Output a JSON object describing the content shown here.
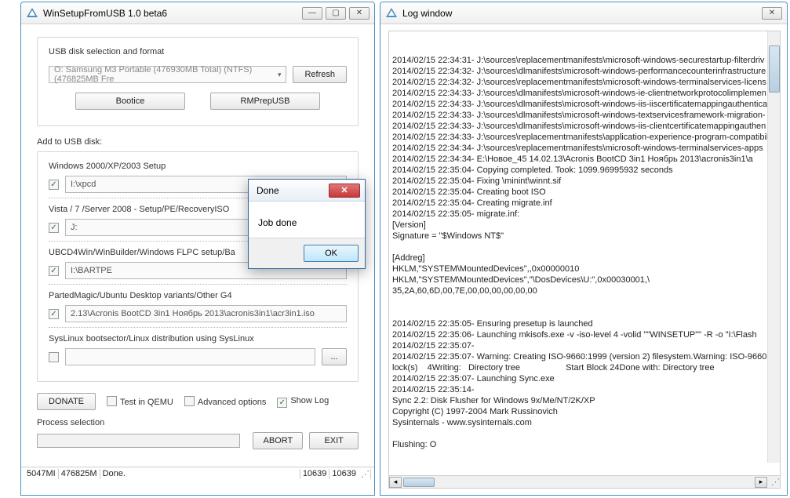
{
  "mainWindow": {
    "title": "WinSetupFromUSB 1.0 beta6",
    "usbSection": {
      "label": "USB disk selection and format",
      "diskSelect": "O: Samsung M3 Portable (476930MB Total) (NTFS) (476825MB Fre",
      "refreshBtn": "Refresh",
      "booticeBtn": "Bootice",
      "rmprepBtn": "RMPrepUSB"
    },
    "addSection": {
      "label": "Add to USB disk:",
      "items": [
        {
          "label": "Windows 2000/XP/2003 Setup",
          "checked": true,
          "path": "I:\\xpcd"
        },
        {
          "label": "Vista / 7 /Server 2008 - Setup/PE/RecoveryISO",
          "checked": true,
          "path": "J:"
        },
        {
          "label": "UBCD4Win/WinBuilder/Windows FLPC setup/Ba",
          "checked": true,
          "path": "I:\\BARTPE"
        },
        {
          "label": "PartedMagic/Ubuntu Desktop variants/Other G4",
          "checked": true,
          "path": "2.13\\Acronis BootCD 3in1 Ноябрь 2013\\acronis3in1\\acr3in1.iso"
        },
        {
          "label": "SysLinux bootsector/Linux distribution using SysLinux",
          "checked": false,
          "path": ""
        }
      ],
      "dotsBtn": "..."
    },
    "bottom": {
      "donateBtn": "DONATE",
      "testQemu": "Test in QEMU",
      "advOpts": "Advanced options",
      "showLog": "Show Log",
      "processLabel": "Process selection",
      "abortBtn": "ABORT",
      "exitBtn": "EXIT"
    },
    "status": {
      "c1": "5047MI",
      "c2": "476825M",
      "c3": "Done.",
      "c4": "10639",
      "c5": "10639"
    }
  },
  "logWindow": {
    "title": "Log window",
    "lines": "2014/02/15 22:34:31- J:\\sources\\replacementmanifests\\microsoft-windows-securestartup-filterdriv\n2014/02/15 22:34:32- J:\\sources\\dlmanifests\\microsoft-windows-performancecounterinfrastructure\n2014/02/15 22:34:32- J:\\sources\\replacementmanifests\\microsoft-windows-terminalservices-licens\n2014/02/15 22:34:33- J:\\sources\\dlmanifests\\microsoft-windows-ie-clientnetworkprotocolimplemen\n2014/02/15 22:34:33- J:\\sources\\dlmanifests\\microsoft-windows-iis-iiscertificatemappingauthentica\n2014/02/15 22:34:33- J:\\sources\\dlmanifests\\microsoft-windows-textservicesframework-migration-\n2014/02/15 22:34:33- J:\\sources\\dlmanifests\\microsoft-windows-iis-clientcertificatemappingauthen\n2014/02/15 22:34:33- J:\\sources\\replacementmanifests\\application-experience-program-compatibil\n2014/02/15 22:34:34- J:\\sources\\replacementmanifests\\microsoft-windows-terminalservices-apps\n2014/02/15 22:34:34- E:\\Новое_45 14.02.13\\Acronis BootCD 3in1 Ноябрь 2013\\acronis3in1\\a\n2014/02/15 22:35:04- Copying completed. Took: 1099.96995932 seconds\n2014/02/15 22:35:04- Fixing \\minint\\winnt.sif\n2014/02/15 22:35:04- Creating boot ISO\n2014/02/15 22:35:04- Creating migrate.inf\n2014/02/15 22:35:05- migrate.inf:\n[Version]\nSignature = \"$Windows NT$\"\n\n[Addreg]\nHKLM,\"SYSTEM\\MountedDevices\",,0x00000010\nHKLM,\"SYSTEM\\MountedDevices\",\"\\DosDevices\\U:\",0x00030001,\\\n35,2A,60,6D,00,7E,00,00,00,00,00,00\n\n\n2014/02/15 22:35:05- Ensuring presetup is launched\n2014/02/15 22:35:06- Launching mkisofs.exe -v -iso-level 4 -volid \"\"WINSETUP\"\" -R -o \"I:\\Flash\n2014/02/15 22:35:07-\n2014/02/15 22:35:07- Warning: Creating ISO-9660:1999 (version 2) filesystem.Warning: ISO-9660\nlock(s)    4Writing:   Directory tree                   Start Block 24Done with: Directory tree\n2014/02/15 22:35:07- Launching Sync.exe\n2014/02/15 22:35:14-\nSync 2.2: Disk Flusher for Windows 9x/Me/NT/2K/XP\nCopyright (C) 1997-2004 Mark Russinovich\nSysinternals - www.sysinternals.com\n\nFlushing: O"
  },
  "dialog": {
    "title": "Done",
    "message": "Job done",
    "okBtn": "OK"
  }
}
